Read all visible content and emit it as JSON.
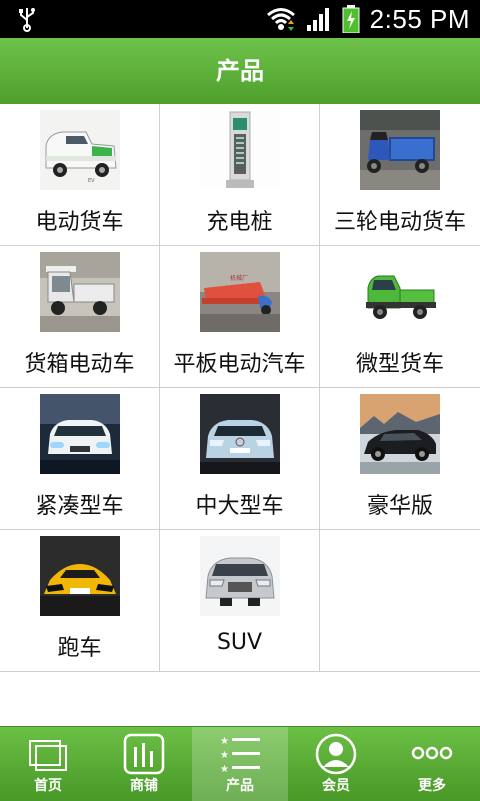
{
  "status_bar": {
    "time": "2:55 PM",
    "icons": [
      "usb-icon",
      "wifi-icon",
      "signal-icon",
      "battery-charging-icon"
    ]
  },
  "header": {
    "title": "产品"
  },
  "products": [
    {
      "label": "电动货车",
      "icon": "electric-van-image"
    },
    {
      "label": "充电桩",
      "icon": "charging-pile-image"
    },
    {
      "label": "三轮电动货车",
      "icon": "electric-tricycle-image"
    },
    {
      "label": "货箱电动车",
      "icon": "cargo-box-ev-image"
    },
    {
      "label": "平板电动汽车",
      "icon": "flatbed-ev-image"
    },
    {
      "label": "微型货车",
      "icon": "mini-truck-image"
    },
    {
      "label": "紧凑型车",
      "icon": "compact-car-image"
    },
    {
      "label": "中大型车",
      "icon": "midsize-car-image"
    },
    {
      "label": "豪华版",
      "icon": "luxury-car-image"
    },
    {
      "label": "跑车",
      "icon": "sports-car-image"
    },
    {
      "label": "SUV",
      "icon": "suv-image"
    }
  ],
  "bottom_nav": [
    {
      "label": "首页",
      "icon": "home-icon"
    },
    {
      "label": "商铺",
      "icon": "shop-icon"
    },
    {
      "label": "产品",
      "icon": "product-list-icon",
      "active": true
    },
    {
      "label": "会员",
      "icon": "member-icon"
    },
    {
      "label": "更多",
      "icon": "more-icon"
    }
  ],
  "colors": {
    "accent": "#5aaf36",
    "status_bar": "#000000",
    "grid_line": "#cfcfcf"
  }
}
